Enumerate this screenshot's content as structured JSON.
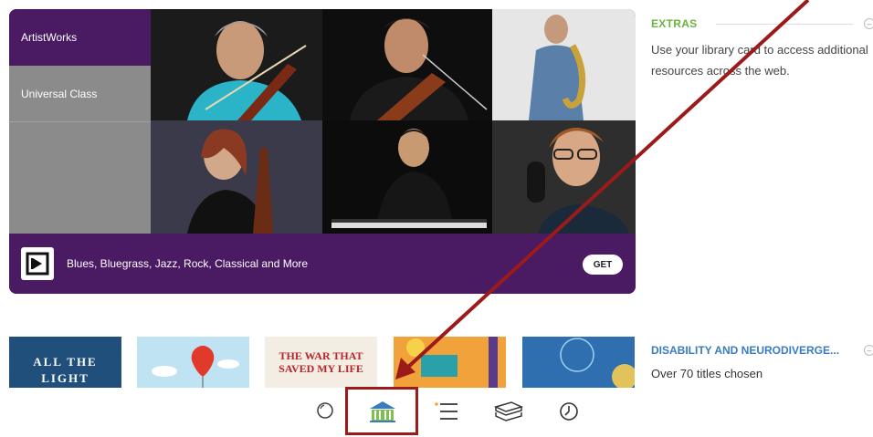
{
  "sidebar": {
    "items": [
      {
        "label": "ArtistWorks",
        "active": true
      },
      {
        "label": "Universal Class",
        "active": false
      }
    ]
  },
  "banner": {
    "text": "Blues, Bluegrass, Jazz, Rock, Classical and More",
    "get_label": "GET"
  },
  "extras": {
    "heading": "EXTRAS",
    "description": "Use your library card to access additional resources across the web."
  },
  "list_section": {
    "heading": "DISABILITY AND NEURODIVERGE...",
    "subtitle": "Over 70 titles chosen"
  },
  "books": [
    {
      "title_line1": "ALL THE",
      "title_line2": "LIGHT",
      "color": "#1f4f7a"
    },
    {
      "title_line1": "",
      "title_line2": "",
      "color": "#bfe3f2"
    },
    {
      "title_line1": "THE WAR THAT",
      "title_line2": "SAVED MY LIFE",
      "color": "#f3ede4"
    },
    {
      "title_line1": "",
      "title_line2": "",
      "color": "#f2a23a"
    },
    {
      "title_line1": "",
      "title_line2": "",
      "color": "#2f6fb0"
    }
  ],
  "nav": {
    "icons": [
      "search-icon",
      "library-icon",
      "menu-icon",
      "books-icon",
      "clock-icon"
    ]
  },
  "colors": {
    "brand_purple": "#4a1a63",
    "extras_green": "#6cb33f",
    "list_blue": "#3a7bbf",
    "annotation_red": "#9b1b1b"
  }
}
